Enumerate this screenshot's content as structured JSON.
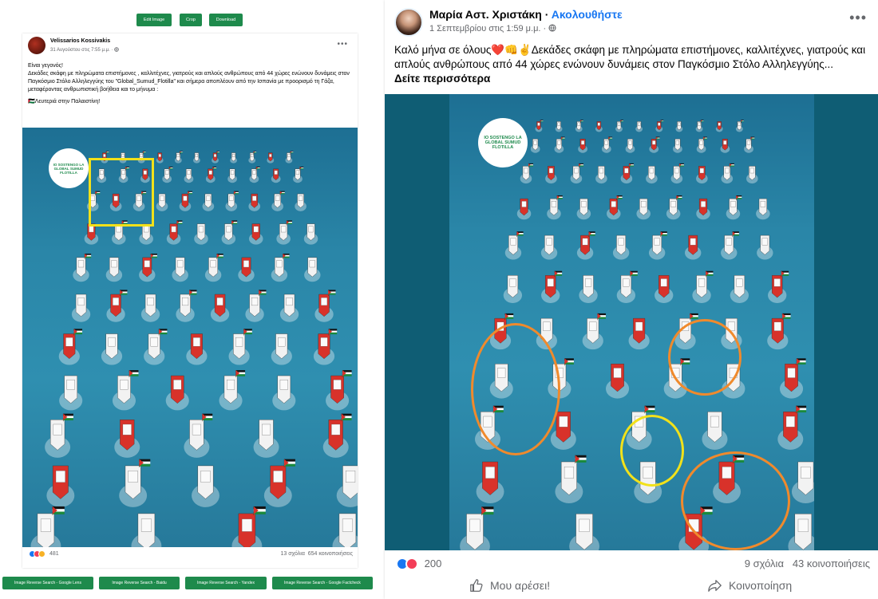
{
  "left": {
    "toolbar": {
      "edit_label": "Edit Image",
      "crop_label": "Crop",
      "download_label": "Download"
    },
    "post": {
      "author": "Velissarios Kossivakis",
      "date": "31 Αυγούστου στις 7:55 μ.μ. · ",
      "text_line1": "Είναι γεγονός!",
      "text_line2": "Δεκάδες σκάφη με πληρώματα επιστήμονες , καλλιτέχνες, γιατρούς και απλούς ανθρώπους από 44 χώρες ενώνουν δυνάμεις στον Παγκόσμιο Στόλο Αλληλεγγύης του \"Global_Sumud_Flotilla\" και σήμερα αποπλέουν από την Ισπανία με προορισμό τη Γάζα, μεταφέροντας ανθρωπιστική βοήθεια και το μήνυμα :",
      "text_line3": "🇵🇸Λευτεριά στην Παλαιστίνη!",
      "image_logo": "IO SOSTENGO LA GLOBAL SUMUD FLOTILLA",
      "reaction_count": "481",
      "comments": "13 σχόλια",
      "shares": "654 κοινοποιήσεις"
    },
    "search_buttons": [
      "Image Reverse Search - Google Lens",
      "Image Reverse Search - Baidu",
      "Image Reverse Search - Yandex",
      "Image Reverse Search - Google Factcheck"
    ]
  },
  "right": {
    "post": {
      "author": "Μαρία Αστ. Χριστάκη",
      "separator": " · ",
      "follow": "Ακολουθήστε",
      "date": "1 Σεπτεμβρίου στις 1:59 μ.μ. · ",
      "text": "Καλό μήνα σε όλους❤️👊✌️Δεκάδες σκάφη με πληρώματα επιστήμονες, καλλιτέχνες, γιατρούς και απλούς ανθρώπους από 44 χώρες ενώνουν δυνάμεις στον Παγκόσμιο Στόλο Αλληλεγγύης...",
      "see_more": "Δείτε περισσότερα",
      "image_logo": "IO SOSTENGO LA GLOBAL SUMUD FLOTILLA",
      "reaction_count": "200",
      "comments": "9 σχόλια",
      "shares": "43 κοινοποιήσεις",
      "like_label": "Μου αρέσει!",
      "share_label": "Κοινοποίηση"
    }
  },
  "icons": [
    "globe-icon",
    "more-icon",
    "like-icon",
    "love-icon",
    "haha-icon",
    "thumbs-up-icon",
    "share-icon"
  ],
  "colors": {
    "facebook_blue": "#1877f2",
    "tool_green": "#1e8a4c",
    "highlight_yellow": "#f2e11a",
    "highlight_orange": "#f08a2c"
  }
}
